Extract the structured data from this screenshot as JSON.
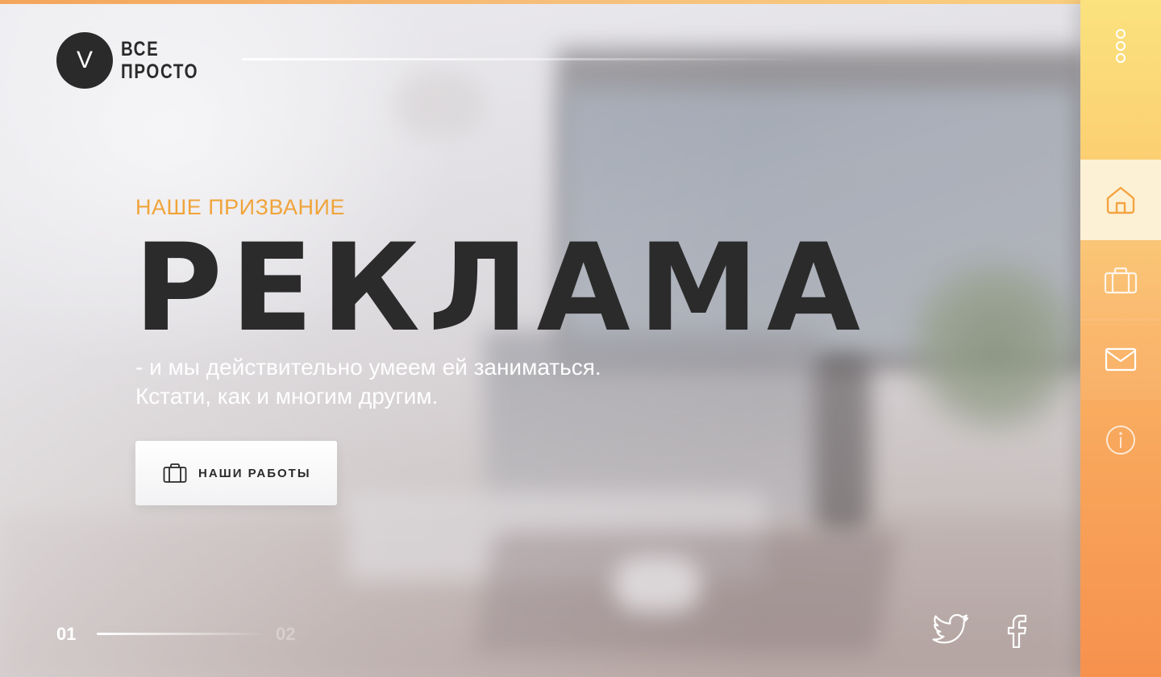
{
  "brand": {
    "logo_letter": "V",
    "name_line1": "ВСЕ",
    "name_line2": "ПРОСТО"
  },
  "hero": {
    "eyebrow": "НАШЕ ПРИЗВАНИЕ",
    "headline": "РЕКЛАМА",
    "subtitle_line1": "- и мы действительно умеем ей заниматься.",
    "subtitle_line2": "Кстати, как и многим другим.",
    "cta_label": "НАШИ РАБОТЫ",
    "cta_icon": "briefcase-icon"
  },
  "pager": {
    "current": "01",
    "next": "02"
  },
  "social": [
    "twitter-icon",
    "facebook-icon"
  ],
  "nav_rail": {
    "menu_icon": "more-vertical-icon",
    "items": [
      {
        "icon": "home-icon",
        "active": true
      },
      {
        "icon": "briefcase-icon",
        "active": false
      },
      {
        "icon": "mail-icon",
        "active": false
      },
      {
        "icon": "info-icon",
        "active": false
      }
    ]
  },
  "colors": {
    "accent": "#f0a43a",
    "rail_top": "#fbe27f",
    "rail_bottom": "#f6914e",
    "dark": "#2c2b2c"
  }
}
